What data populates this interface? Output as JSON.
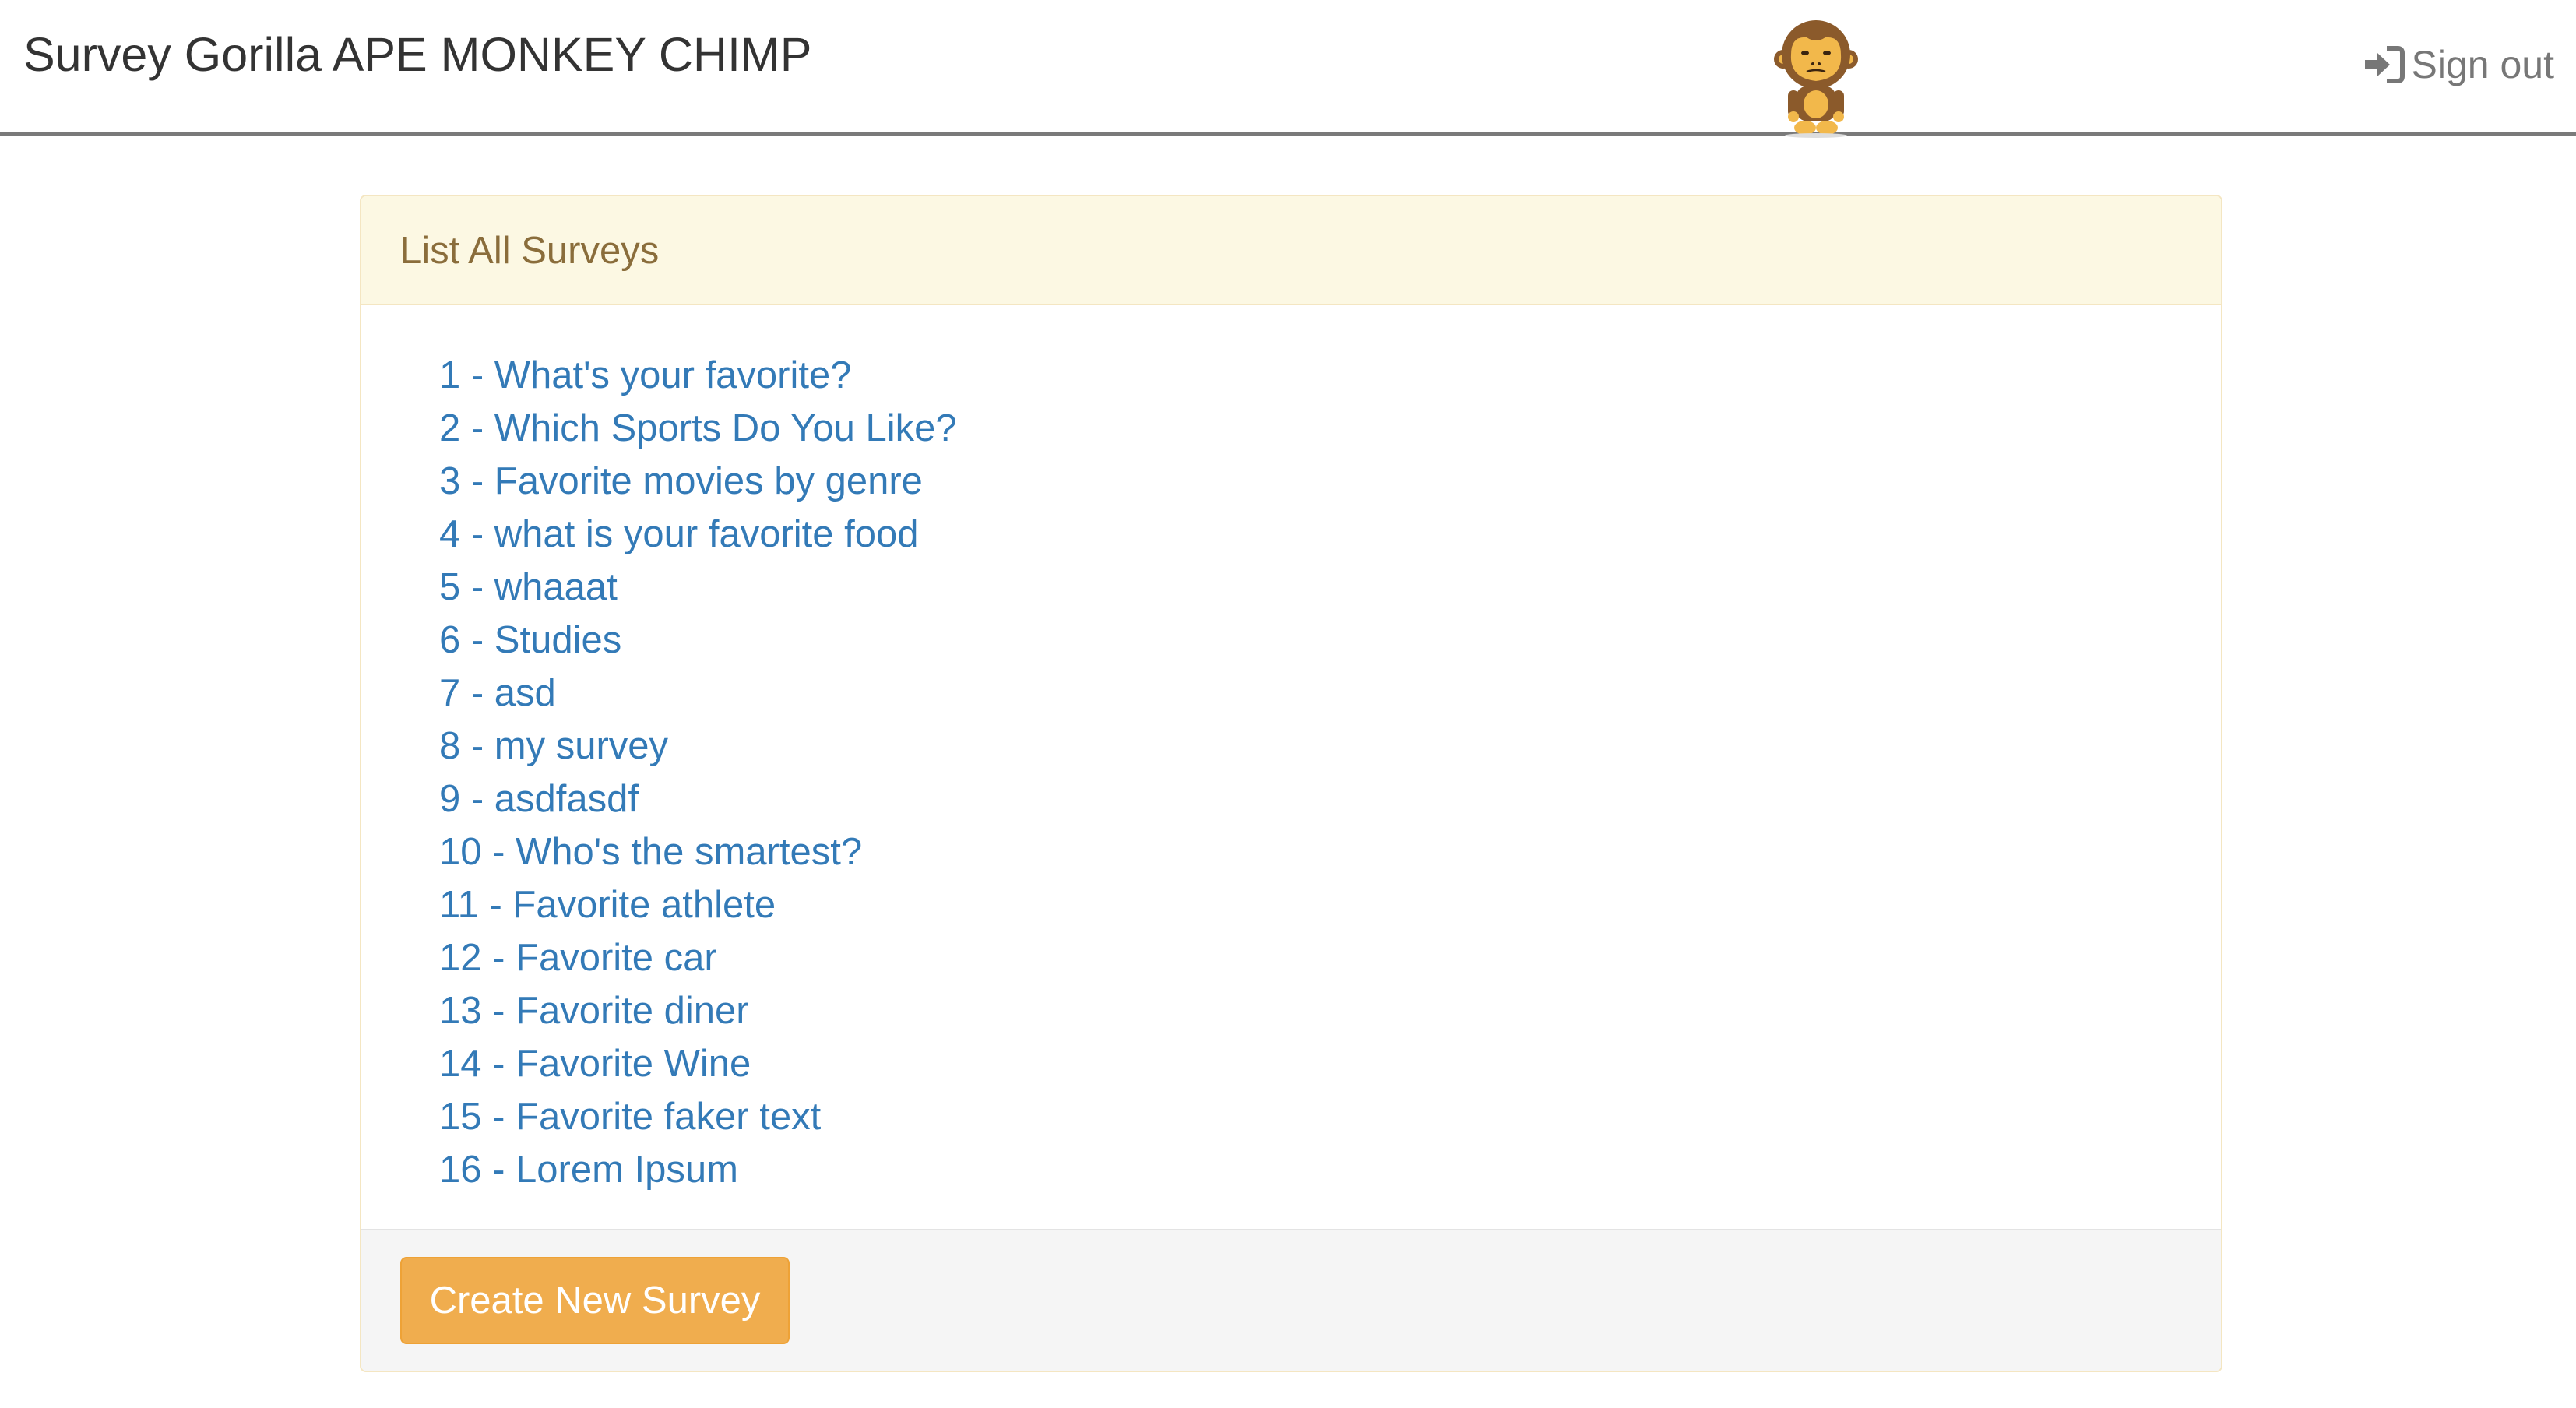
{
  "navbar": {
    "brand": "Survey Gorilla APE MONKEY CHIMP",
    "mascot_icon": "monkey-mascot-icon",
    "signout_label": "Sign out",
    "signout_icon": "sign-in-arrow-icon"
  },
  "panel": {
    "title": "List All Surveys",
    "surveys": [
      "1 - What's your favorite?",
      "2 - Which Sports Do You Like?",
      "3 - Favorite movies by genre",
      "4 - what is your favorite food",
      "5 - whaaat",
      "6 - Studies",
      "7 - asd",
      "8 - my survey",
      "9 - asdfasdf",
      "10 - Who's the smartest?",
      "11 - Favorite athlete",
      "12 - Favorite car",
      "13 - Favorite diner",
      "14 - Favorite Wine",
      "15 - Favorite faker text",
      "16 - Lorem Ipsum"
    ],
    "create_button_label": "Create New Survey"
  },
  "colors": {
    "link": "#337ab7",
    "heading_bg": "#fcf8e3",
    "heading_text": "#8a6d3b",
    "warning_button": "#f0ad4e",
    "footer_bg": "#f5f5f5"
  }
}
